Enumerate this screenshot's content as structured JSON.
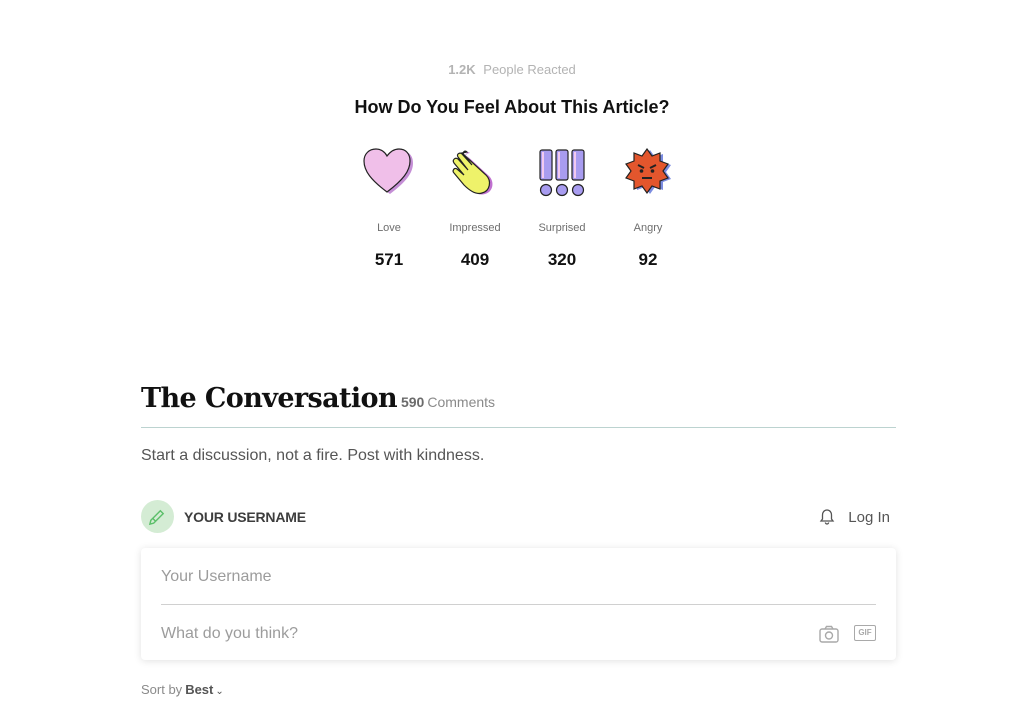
{
  "reactions": {
    "total_count": "1.2K",
    "total_label": "People Reacted",
    "title": "How Do You Feel About This Article?",
    "items": [
      {
        "label": "Love",
        "count": "571",
        "icon": "heart-icon"
      },
      {
        "label": "Impressed",
        "count": "409",
        "icon": "clapping-hands-icon"
      },
      {
        "label": "Surprised",
        "count": "320",
        "icon": "exclamation-icon"
      },
      {
        "label": "Angry",
        "count": "92",
        "icon": "angry-face-icon"
      }
    ]
  },
  "conversation": {
    "title": "The Conversation",
    "comment_count": "590",
    "comment_word": "Comments",
    "subtitle": "Start a discussion, not a fire. Post with kindness."
  },
  "user": {
    "username": "YOUR USERNAME",
    "login_label": "Log In",
    "avatar_icon": "pencil-icon"
  },
  "comment_form": {
    "name_placeholder": "Your Username",
    "text_placeholder": "What do you think?",
    "gif_label": "GIF"
  },
  "sort": {
    "label": "Sort by",
    "value": "Best"
  },
  "colors": {
    "avatar_bg": "#d4ecd4",
    "header_rule": "#bcd3d0",
    "love_pink": "#e8b4e6",
    "impressed_yellow": "#eef26a",
    "surprised_purple": "#a89cf0",
    "angry_orange": "#e3562d"
  }
}
